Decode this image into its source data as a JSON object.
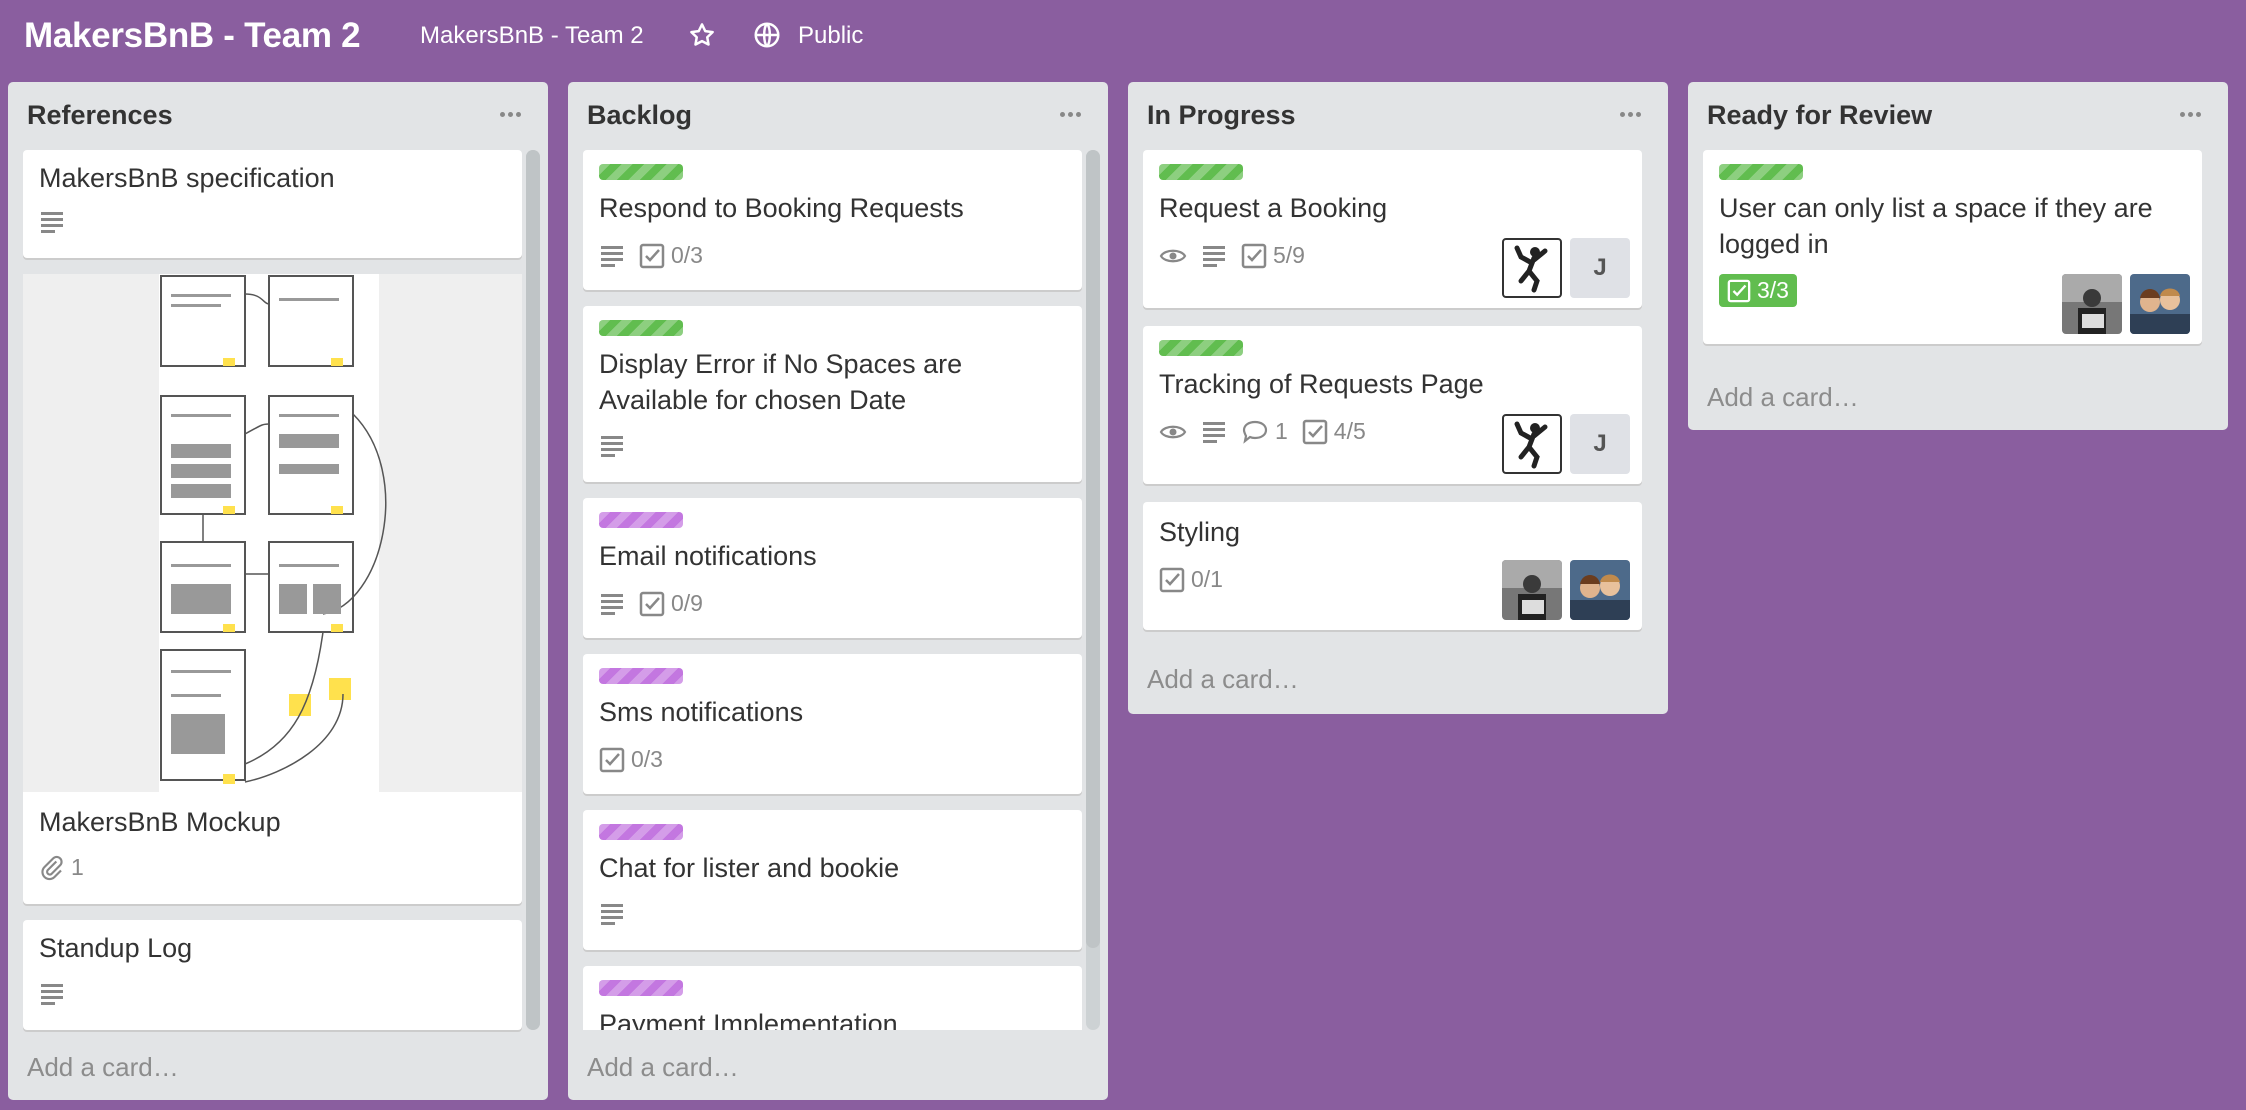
{
  "board": {
    "title": "MakersBnB - Team 2",
    "team": "MakersBnB - Team 2",
    "visibility": "Public"
  },
  "lists": [
    {
      "title": "References",
      "add_card": "Add a card…",
      "cards": [
        {
          "title": "MakersBnB specification"
        },
        {
          "title": "MakersBnB Mockup",
          "attachments": "1"
        },
        {
          "title": "Standup Log"
        }
      ]
    },
    {
      "title": "Backlog",
      "add_card": "Add a card…",
      "cards": [
        {
          "title": "Respond to Booking Requests",
          "checklist": "0/3"
        },
        {
          "title": "Display Error if No Spaces are Available for chosen Date"
        },
        {
          "title": "Email notifications",
          "checklist": "0/9"
        },
        {
          "title": "Sms notifications",
          "checklist": "0/3"
        },
        {
          "title": "Chat for lister and bookie"
        },
        {
          "title": "Payment Implementation"
        }
      ]
    },
    {
      "title": "In Progress",
      "add_card": "Add a card…",
      "cards": [
        {
          "title": "Request a Booking",
          "checklist": "5/9",
          "member_initial": "J"
        },
        {
          "title": "Tracking of Requests Page",
          "comments": "1",
          "checklist": "4/5",
          "member_initial": "J"
        },
        {
          "title": "Styling",
          "checklist": "0/1"
        }
      ]
    },
    {
      "title": "Ready for Review",
      "add_card": "Add a card…",
      "cards": [
        {
          "title": "User can only list a space if they are logged in",
          "checklist": "3/3"
        }
      ]
    }
  ],
  "colors": {
    "board_background": "#8a5e9f",
    "label_green": "#61bd4f",
    "label_purple": "#c377e0",
    "list_background": "#e2e4e6"
  }
}
